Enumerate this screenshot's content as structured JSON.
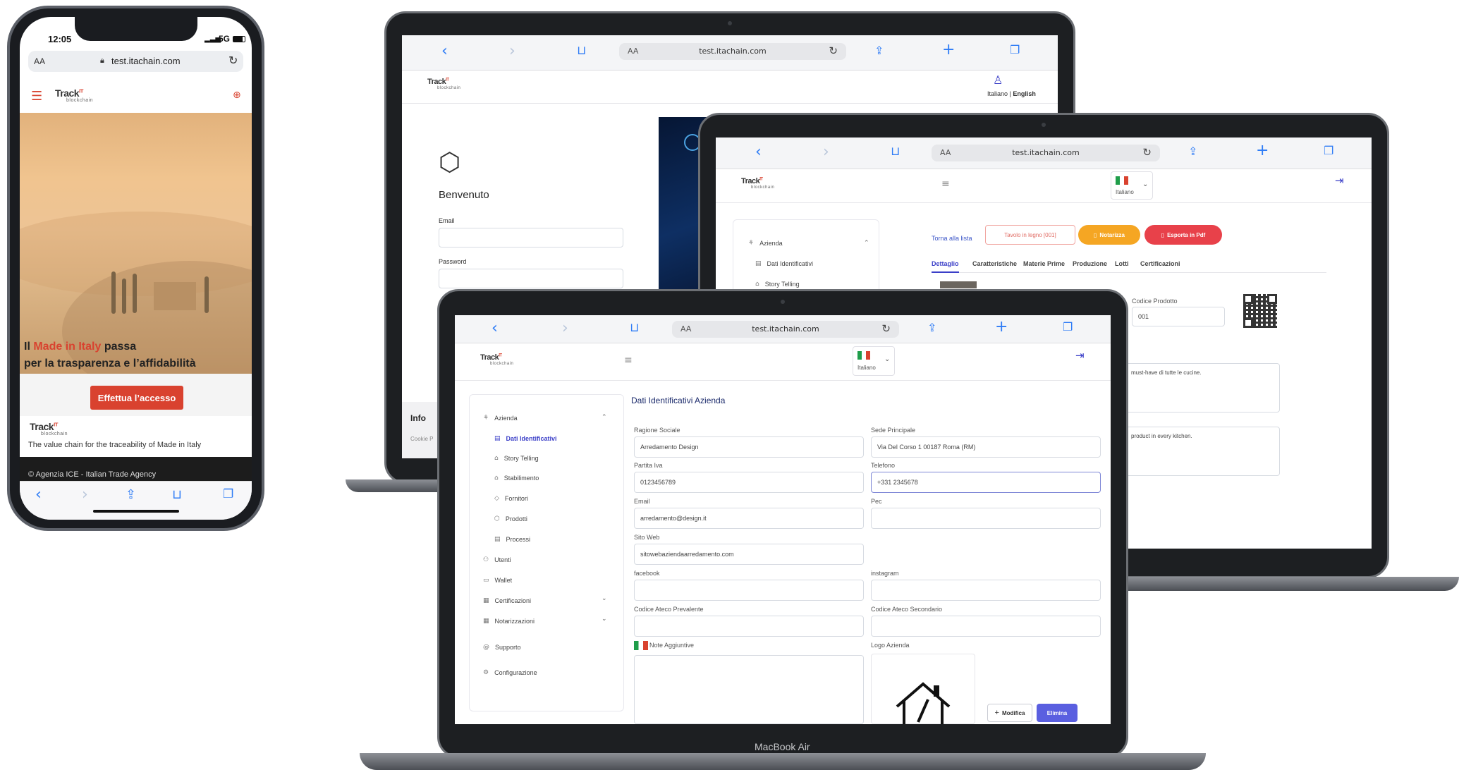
{
  "phone": {
    "time": "12:05",
    "signal": "5G",
    "url_aa": "AA",
    "url": "test.itachain.com",
    "brand": "Track",
    "brand_it": "IT",
    "brand_sub": "blockchain",
    "hero_line1_pre": "Il ",
    "hero_line1_hl": "Made in Italy",
    "hero_line1_post": " passa",
    "hero_line2": "per la trasparenza e l’affidabilità",
    "cta": "Effettua l’accesso",
    "footer_tagline": "The value chain for the traceability of Made in Italy",
    "copyright": "© Agenzia ICE - Italian Trade Agency"
  },
  "login_laptop": {
    "url_aa": "AA",
    "url": "test.itachain.com",
    "lang_italiano": "Italiano",
    "lang_sep": " | ",
    "lang_english": "English",
    "welcome": "Benvenuto",
    "email_label": "Email",
    "password_label": "Password",
    "info": "Info",
    "cookie": "Cookie P"
  },
  "product_laptop": {
    "url_aa": "AA",
    "url": "test.itachain.com",
    "lang": "Italiano",
    "sidebar": [
      {
        "label": "Azienda",
        "icon": "org-icon"
      },
      {
        "label": "Dati Identificativi",
        "icon": "id-card-icon"
      },
      {
        "label": "Story Telling",
        "icon": "home-icon"
      }
    ],
    "back": "Torna alla lista",
    "product_badge": "Tavolo in legno [001]",
    "notarize": "Notarizza",
    "export": "Esporta in Pdf",
    "tabs": [
      "Dettaglio",
      "Caratteristiche",
      "Materie Prime",
      "Produzione",
      "Lotti",
      "Certificazioni"
    ],
    "product_code_label": "Codice Prodotto",
    "product_code": "001",
    "desc_it_snippet": "must-have di tutte le cucine.",
    "desc_en_snippet": "product in every kitchen."
  },
  "main_laptop": {
    "url_aa": "AA",
    "url": "test.itachain.com",
    "lang": "Italiano",
    "brand_name": "MacBook Air",
    "sidebar": [
      {
        "label": "Azienda",
        "icon": "org-icon",
        "chevron": "up"
      },
      {
        "label": "Dati Identificativi",
        "icon": "id-card-icon",
        "active": true
      },
      {
        "label": "Story Telling",
        "icon": "home-icon"
      },
      {
        "label": "Stabilimento",
        "icon": "home-icon"
      },
      {
        "label": "Fornitori",
        "icon": "tag-icon"
      },
      {
        "label": "Prodotti",
        "icon": "box-icon"
      },
      {
        "label": "Processi",
        "icon": "list-icon"
      },
      {
        "label": "Utenti",
        "icon": "users-icon"
      },
      {
        "label": "Wallet",
        "icon": "wallet-icon"
      },
      {
        "label": "Certificazioni",
        "icon": "grid-icon",
        "chevron": "down"
      },
      {
        "label": "Notarizzazioni",
        "icon": "grid-icon",
        "chevron": "down"
      },
      {
        "label": "Supporto",
        "icon": "at-icon"
      },
      {
        "label": "Configurazione",
        "icon": "gear-icon"
      }
    ],
    "title": "Dati Identificativi Azienda",
    "fields": {
      "ragione_sociale_label": "Ragione Sociale",
      "ragione_sociale": "Arredamento Design",
      "sede_label": "Sede Principale",
      "sede": "Via Del Corso 1 00187 Roma (RM)",
      "piva_label": "Partita Iva",
      "piva": "0123456789",
      "telefono_label": "Telefono",
      "telefono": "+331 2345678",
      "email_label": "Email",
      "email": "arredamento@design.it",
      "pec_label": "Pec",
      "pec": "",
      "sito_label": "Sito Web",
      "sito": "sitowebaziendaarredamento.com",
      "facebook_label": "facebook",
      "instagram_label": "instagram",
      "ateco1_label": "Codice Ateco Prevalente",
      "ateco2_label": "Codice Ateco Secondario",
      "note_label": "Note Aggiuntive",
      "logo_label": "Logo Azienda"
    },
    "btn_modifica": "Modifica",
    "btn_elimina": "Elimina"
  },
  "colors": {
    "accent_blue": "#2e7cf6",
    "brand_red": "#d9422f",
    "notarize_orange": "#f5a623",
    "export_red": "#e8414a",
    "primary_purple": "#5a5fe0",
    "dark_footer": "#1c1c1c"
  }
}
